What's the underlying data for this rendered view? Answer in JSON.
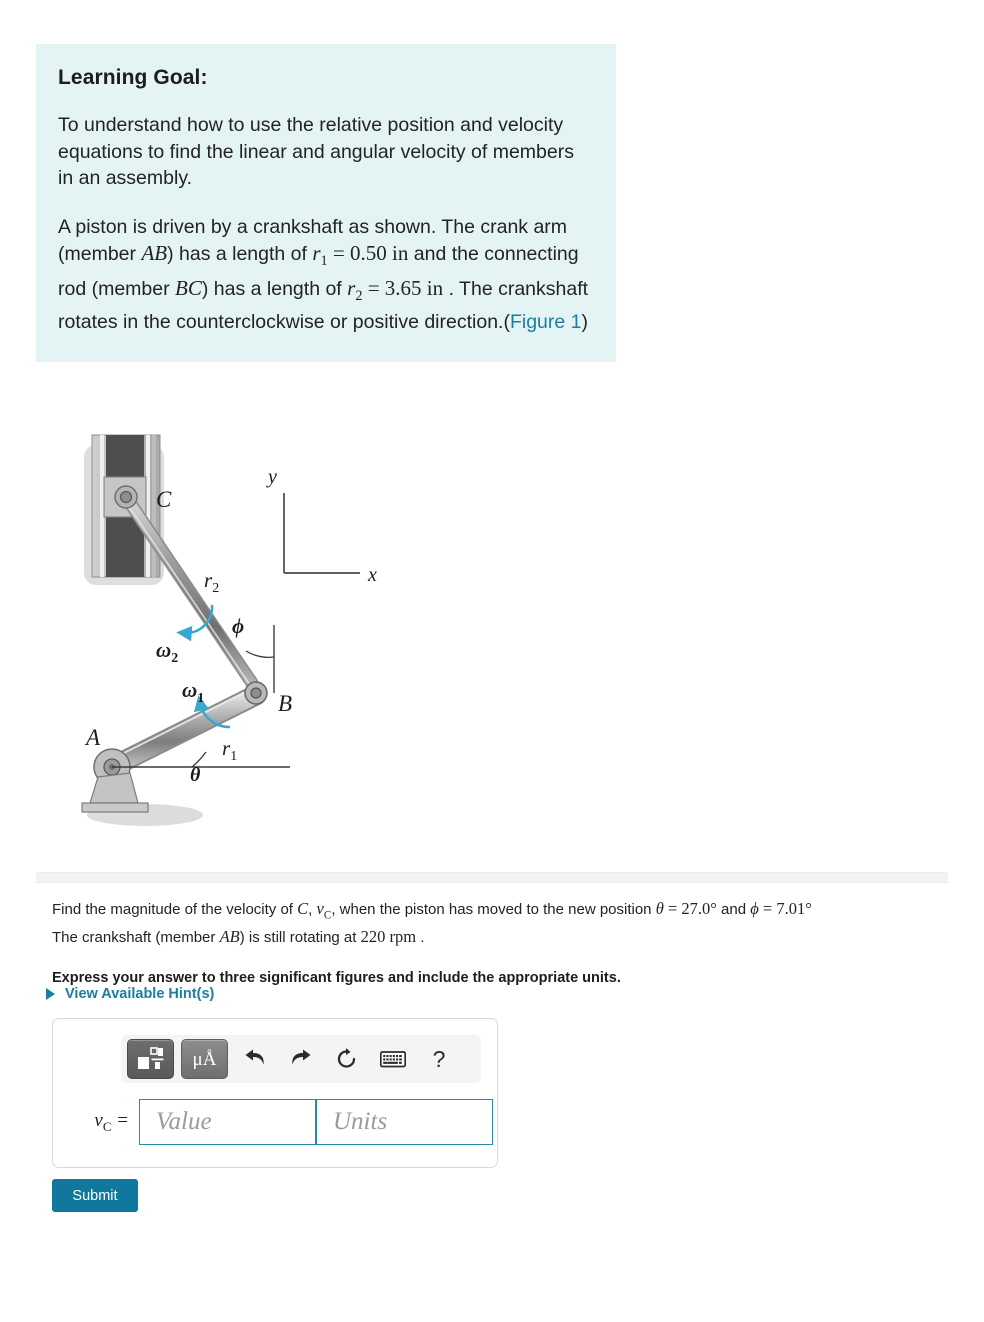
{
  "goal": {
    "title": "Learning Goal:",
    "paragraph1": "To understand how to use the relative position and velocity equations to find the linear and angular velocity of members in an assembly.",
    "p2_a": "A piston is driven by a crankshaft as shown. The crank arm (member ",
    "p2_AB": "AB",
    "p2_b": ") has a length of ",
    "p2_r1": "r",
    "p2_r1_sub": "1",
    "p2_r1_val": " = 0.50 in",
    "p2_c": " and the connecting rod (member ",
    "p2_BC": "BC",
    "p2_d": ") has a length of ",
    "p2_r2": "r",
    "p2_r2_sub": "2",
    "p2_r2_val": " = 3.65 in",
    "p2_e": " . The crankshaft rotates in the counterclockwise or positive direction.(",
    "figure_link": "Figure 1",
    "p2_f": ")"
  },
  "figure": {
    "label_A": "A",
    "label_B": "B",
    "label_C": "C",
    "label_r1": "r",
    "label_r1_sub": "1",
    "label_r2": "r",
    "label_r2_sub": "2",
    "label_w1": "ω",
    "label_w1_sub": "1",
    "label_w2": "ω",
    "label_w2_sub": "2",
    "label_theta": "θ",
    "label_phi": "ϕ",
    "axis_x": "x",
    "axis_y": "y",
    "colors": {
      "arrow": "#3aa7d0",
      "metal_dark": "#5a5a5a",
      "metal_mid": "#9a9a9a",
      "metal_light": "#cfcfcf",
      "shadow": "#d5d5d5"
    }
  },
  "question": {
    "line1_a": "Find the magnitude of the velocity of ",
    "line1_C": "C",
    "line1_b": ", ",
    "line1_v": "v",
    "line1_v_sub": "C",
    "line1_c": ", when the piston has moved to the new position ",
    "line1_theta": "θ",
    "line1_theta_val": " = 27.0°",
    "line1_d": " and ",
    "line1_phi": "ϕ",
    "line1_phi_val": " = 7.01°",
    "line2_a": "The crankshaft (member ",
    "line2_AB": "AB",
    "line2_b": ") is still rotating at ",
    "line2_rpm": "220 rpm",
    "line2_c": " .",
    "instruction": "Express your answer to three significant figures and include the appropriate units.",
    "hints_label": "View Available Hint(s)"
  },
  "answer": {
    "toolbar": {
      "template_icon": "math-template-icon",
      "units_label": "μÅ",
      "undo_icon": "undo-arrow-icon",
      "redo_icon": "redo-arrow-icon",
      "reset_icon": "reset-circular-arrow-icon",
      "keyboard_icon": "keyboard-icon",
      "help_label": "?"
    },
    "var_symbol": "v",
    "var_subscript": "C",
    "equals": " =",
    "value_placeholder": "Value",
    "units_placeholder": "Units"
  },
  "submit": {
    "label": "Submit"
  },
  "theme": {
    "panel_bg": "#e4f3f3",
    "link": "#1a7e9c",
    "submit_bg": "#10789c",
    "field_border": "#2e89a8"
  }
}
